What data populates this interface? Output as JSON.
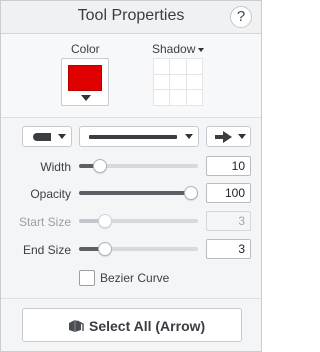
{
  "header": {
    "title": "Tool Properties",
    "help_label": "?"
  },
  "color": {
    "label": "Color",
    "value": "#E00000"
  },
  "shadow": {
    "label": "Shadow"
  },
  "toolbar": {
    "line_cap_icon": "line-cap-icon",
    "line_style_icon": "line-style-icon",
    "arrow_style_icon": "arrow-right-icon"
  },
  "properties": {
    "width": {
      "label": "Width",
      "value": "10",
      "level": 0.18
    },
    "opacity": {
      "label": "Opacity",
      "value": "100",
      "level": 1.0
    },
    "start_size": {
      "label": "Start Size",
      "value": "3",
      "level": 0.22
    },
    "end_size": {
      "label": "End Size",
      "value": "3",
      "level": 0.22
    }
  },
  "bezier": {
    "label": "Bezier Curve",
    "checked": false
  },
  "select_all": {
    "label": "Select All (Arrow)"
  },
  "colors": {
    "accent": "#E00000",
    "track_fill": "#5C5F66",
    "track_bg": "#D6D9DE"
  }
}
